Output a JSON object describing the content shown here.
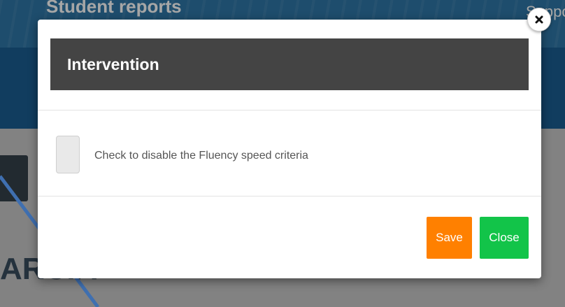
{
  "background_app": {
    "header_title": "Student reports",
    "support_text": "Support",
    "name_text": "ARCIA"
  },
  "modal": {
    "title": "Intervention",
    "checkbox_label": "Check to disable the Fluency speed criteria",
    "checkbox_checked": false,
    "save_label": "Save",
    "close_label": "Close",
    "close_icon": "close-icon"
  },
  "colors": {
    "header_dark": "#444444",
    "save_button": "#ff8000",
    "close_button": "#12c449",
    "app_header": "#1b5f93",
    "annotation_arrow": "#3f6fb0"
  }
}
